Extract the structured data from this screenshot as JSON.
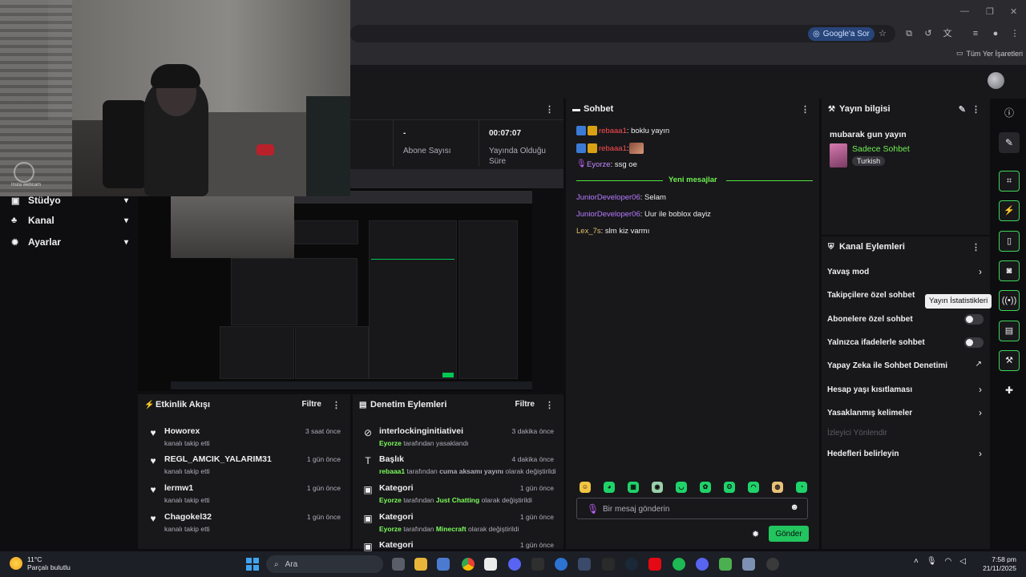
{
  "browser": {
    "google_sor": "Google'a Sor",
    "bookmarks": "Tüm Yer İşaretleri"
  },
  "webcam": {
    "label": "Insta webcam"
  },
  "sidebar": {
    "items": [
      {
        "label": "Stüdyo",
        "icon": "studio-icon"
      },
      {
        "label": "Kanal",
        "icon": "people-icon"
      },
      {
        "label": "Ayarlar",
        "icon": "gear-icon"
      }
    ]
  },
  "stats": {
    "subscribers_value": "-",
    "subscribers_label": "Abone Sayısı",
    "live_value": "00:07:07",
    "live_label_1": "Yayında Olduğu",
    "live_label_2": "Süre"
  },
  "activity": {
    "title": "Etkinlik Akışı",
    "filter": "Filtre",
    "items": [
      {
        "name": "Howorex",
        "sub": "kanalı takip etti",
        "time": "3 saat önce"
      },
      {
        "name": "REGL_AMCIK_YALARIM31",
        "sub": "kanalı takip etti",
        "time": "1 gün önce"
      },
      {
        "name": "lermw1",
        "sub": "kanalı takip etti",
        "time": "1 gün önce"
      },
      {
        "name": "Chagokel32",
        "sub": "kanalı takip etti",
        "time": "1 gün önce"
      }
    ]
  },
  "moderation": {
    "title": "Denetim Eylemleri",
    "filter": "Filtre",
    "items": [
      {
        "name": "interlockinginitiativei",
        "actor": "Eyorze",
        "pre": " tarafından ",
        "value": "",
        "post": "yasaklandı",
        "time": "3 dakika önce",
        "icon": "ban-icon"
      },
      {
        "name": "Başlık",
        "actor": "rebaaa1",
        "pre": " tarafından ",
        "value": "cuma aksamı yayını",
        "post": " olarak değiştirildi",
        "time": "4 dakika önce",
        "icon": "text-icon"
      },
      {
        "name": "Kategori",
        "actor": "Eyorze",
        "pre": " tarafından ",
        "value": "Just Chatting",
        "post": " olarak değiştirildi",
        "time": "1 gün önce",
        "icon": "category-icon"
      },
      {
        "name": "Kategori",
        "actor": "Eyorze",
        "pre": " tarafından ",
        "value": "Minecraft",
        "post": " olarak değiştirildi",
        "time": "1 gün önce",
        "icon": "category-icon"
      },
      {
        "name": "Kategori",
        "actor": "",
        "pre": "",
        "value": "",
        "post": "",
        "time": "1 gün önce",
        "icon": "category-icon"
      }
    ]
  },
  "chat": {
    "title": "Sohbet",
    "messages": [
      {
        "user": "rebaaa1",
        "text": ": boklu yayın"
      },
      {
        "user": "rebaaa1",
        "text": ": "
      },
      {
        "user": "Eyorze",
        "text": ": ssg oe"
      }
    ],
    "new_messages": "Yeni mesajlar",
    "new": [
      {
        "user": "JuniorDeveloper06",
        "text": ": Selam"
      },
      {
        "user": "JuniorDeveloper06",
        "text": ": Uur ile boblox dayiz"
      },
      {
        "user": "Lex_7s",
        "text": ": slm kiz varmı"
      }
    ],
    "input_placeholder": "Bir mesaj gönderin",
    "send": "Gönder"
  },
  "stream_info": {
    "title": "Yayın bilgisi",
    "stream_title": "mubarak gun yayın",
    "category": "Sadece Sohbet",
    "language": "Turkish"
  },
  "actions": {
    "title": "Kanal Eylemleri",
    "items": [
      {
        "label": "Yavaş mod",
        "control": "chevron"
      },
      {
        "label": "Takipçilere özel sohbet",
        "control": "toggle"
      },
      {
        "label": "Abonelere özel sohbet",
        "control": "toggle"
      },
      {
        "label": "Yalnızca ifadelerle sohbet",
        "control": "toggle"
      },
      {
        "label": "Yapay Zeka ile Sohbet Denetimi",
        "control": "external"
      },
      {
        "label": "Hesap yaşı kısıtlaması",
        "control": "chevron"
      },
      {
        "label": "Yasaklanmış kelimeler",
        "control": "chevron"
      },
      {
        "label": "İzleyici Yönlendir",
        "control": "disabled"
      },
      {
        "label": "Hedefleri belirleyin",
        "control": "chevron"
      }
    ]
  },
  "tooltip": "Yayın İstatistikleri",
  "taskbar": {
    "temp": "11°C",
    "weather": "Parçalı bulutlu",
    "search": "Ara",
    "time": "7:58 pm",
    "date": "21/11/2025"
  },
  "colors": {
    "accent_green": "#53fc18",
    "panel": "#18181b",
    "bg": "#0e0e10"
  }
}
